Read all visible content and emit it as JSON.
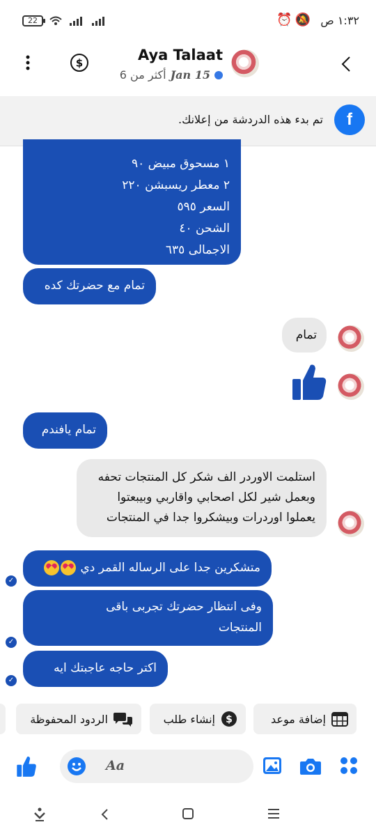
{
  "status_bar": {
    "battery": "22",
    "time": "١:٣٢ ص"
  },
  "header": {
    "contact_name": "Aya Talaat",
    "last_active_date": "Jan 15",
    "more_than": "أكثر من 6"
  },
  "ad_banner": {
    "text": "تم بدء هذه الدردشة من إعلانك."
  },
  "messages": [
    {
      "type": "outgoing",
      "lines": [
        "١ مسحوق مبيض ٩٠",
        "٢ معطر ريسبشن ٢٢٠",
        "السعر ٥٩٥",
        "الشحن ٤٠",
        "الاجمالى ٦٣٥"
      ]
    },
    {
      "type": "outgoing",
      "text": "تمام مع حضرتك كده"
    },
    {
      "type": "incoming",
      "text": "تمام"
    },
    {
      "type": "incoming",
      "text": "like"
    },
    {
      "type": "outgoing",
      "text": "تمام يافندم"
    },
    {
      "type": "incoming",
      "lines": [
        "استلمت الاوردر الف شكر كل المنتجات تحفه",
        "وبعمل شير لكل اصحابي واقاربي وبيبعتوا",
        "يعملوا اوردرات وبيشكروا جدا في المنتجات"
      ]
    },
    {
      "type": "outgoing",
      "text": "متشكرين جدا على الرساله القمر دي"
    },
    {
      "type": "outgoing",
      "lines": [
        "وفى انتظار حضرتك تجربى باقى",
        "المنتجات"
      ]
    },
    {
      "type": "outgoing",
      "text": "اكتر حاجه عاجبتك ايه"
    }
  ],
  "quick_replies": [
    {
      "label": "إضافة موعد",
      "icon": "calendar-icon"
    },
    {
      "label": "إنشاء طلب",
      "icon": "dollar-icon"
    },
    {
      "label": "الردود المحفوظة",
      "icon": "chat-bubbles-icon"
    }
  ],
  "composer": {
    "placeholder": "Aa"
  },
  "colors": {
    "messenger_blue": "#1a4fb4",
    "incoming_gray": "#e9e9e9",
    "accent_blue": "#1877f2"
  }
}
